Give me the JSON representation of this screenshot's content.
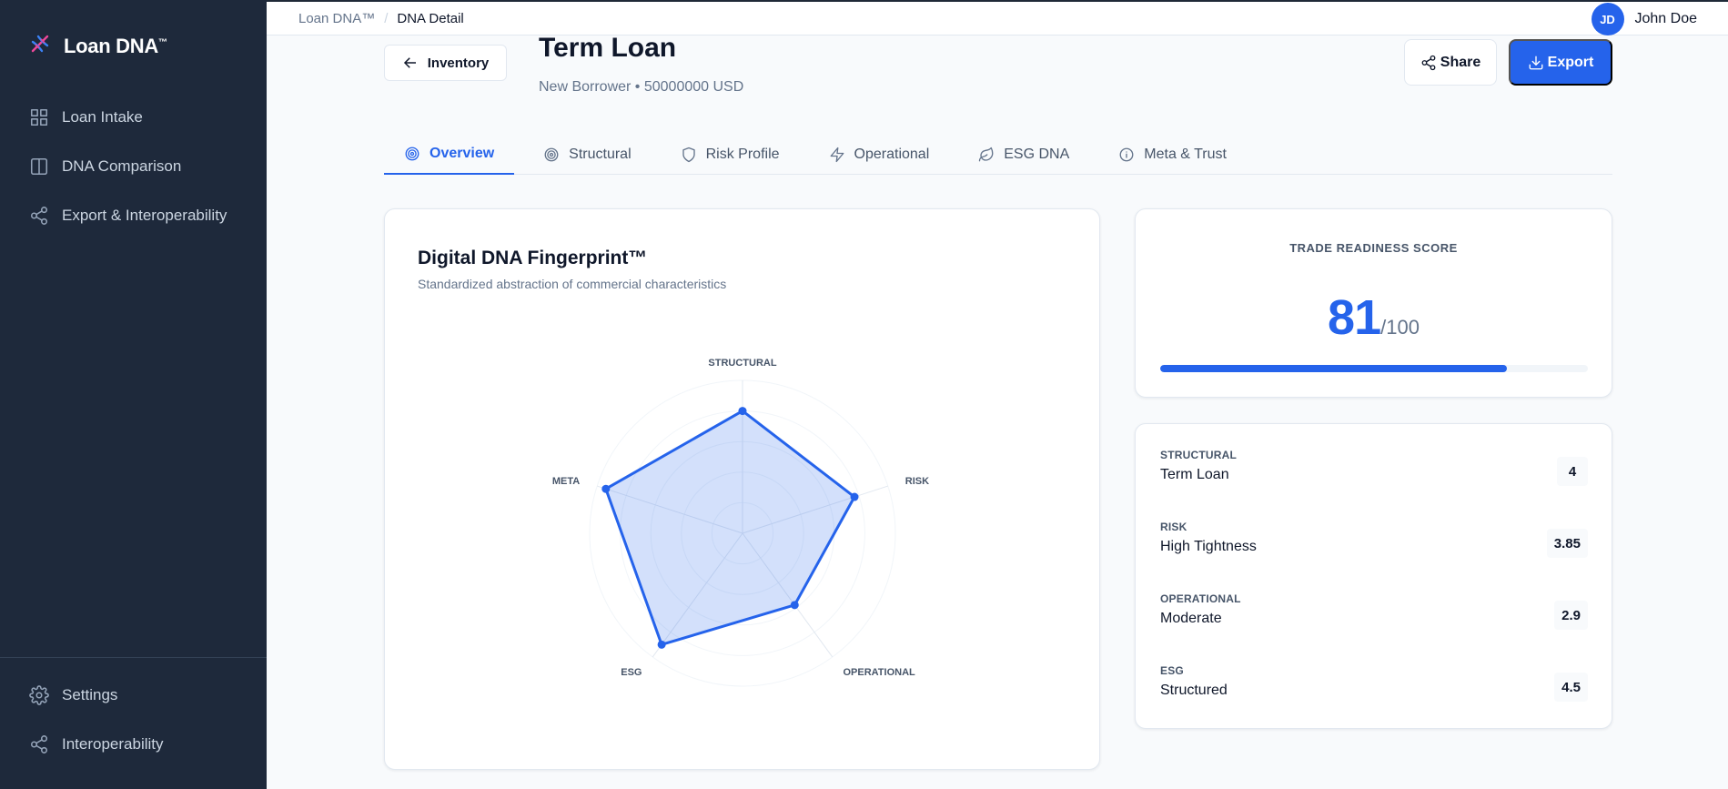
{
  "brand": {
    "name": "Loan DNA",
    "tm": "™"
  },
  "sidebar": {
    "items": [
      {
        "label": "Loan Intake",
        "icon": "grid-icon"
      },
      {
        "label": "DNA Comparison",
        "icon": "columns-icon"
      },
      {
        "label": "Export & Interoperability",
        "icon": "share-nodes-icon"
      }
    ],
    "bottom_items": [
      {
        "label": "Settings",
        "icon": "gear-icon"
      },
      {
        "label": "Interoperability",
        "icon": "share-nodes-icon"
      }
    ]
  },
  "breadcrumb": {
    "root": "Loan DNA™",
    "separator": "/",
    "current": "DNA Detail"
  },
  "user": {
    "initials": "JD",
    "name": "John Doe"
  },
  "header": {
    "back_label": "Inventory",
    "title": "Term Loan",
    "subtitle": "New Borrower • 50000000 USD",
    "share_label": "Share",
    "export_label": "Export"
  },
  "tabs": [
    {
      "label": "Overview",
      "icon": "target-icon",
      "active": true
    },
    {
      "label": "Structural",
      "icon": "target-icon",
      "active": false
    },
    {
      "label": "Risk Profile",
      "icon": "shield-icon",
      "active": false
    },
    {
      "label": "Operational",
      "icon": "bolt-icon",
      "active": false
    },
    {
      "label": "ESG DNA",
      "icon": "leaf-icon",
      "active": false
    },
    {
      "label": "Meta & Trust",
      "icon": "info-icon",
      "active": false
    }
  ],
  "fingerprint": {
    "title": "Digital DNA Fingerprint™",
    "subtitle": "Standardized abstraction of commercial characteristics"
  },
  "chart_data": {
    "type": "radar",
    "categories": [
      "STRUCTURAL",
      "RISK",
      "OPERATIONAL",
      "ESG",
      "META"
    ],
    "values": [
      4,
      3.85,
      2.9,
      4.5,
      4.7
    ],
    "range": [
      0,
      5
    ],
    "color": "#2563eb"
  },
  "score": {
    "label": "TRADE READINESS SCORE",
    "value": "81",
    "max": "/100",
    "fraction": 0.81
  },
  "dimensions": [
    {
      "label": "STRUCTURAL",
      "value": "Term Loan",
      "score": "4"
    },
    {
      "label": "RISK",
      "value": "High Tightness",
      "score": "3.85"
    },
    {
      "label": "OPERATIONAL",
      "value": "Moderate",
      "score": "2.9"
    },
    {
      "label": "ESG",
      "value": "Structured",
      "score": "4.5"
    }
  ]
}
